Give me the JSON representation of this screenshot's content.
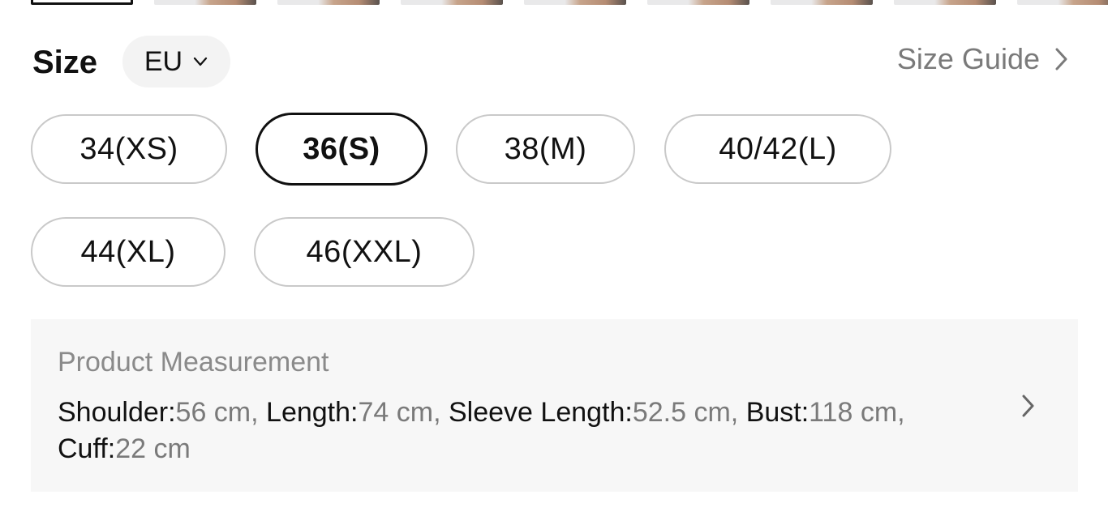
{
  "size_section": {
    "title": "Size",
    "unit": "EU",
    "size_guide_label": "Size Guide"
  },
  "sizes": [
    {
      "label": "34(XS)",
      "selected": false
    },
    {
      "label": "36(S)",
      "selected": true
    },
    {
      "label": "38(M)",
      "selected": false
    },
    {
      "label": "40/42(L)",
      "selected": false
    },
    {
      "label": "44(XL)",
      "selected": false
    },
    {
      "label": "46(XXL)",
      "selected": false
    }
  ],
  "measurement": {
    "title": "Product Measurement",
    "items": [
      {
        "name": "Shoulder:",
        "value": "56 cm,"
      },
      {
        "name": "Length:",
        "value": "74 cm,"
      },
      {
        "name": "Sleeve Length:",
        "value": "52.5 cm,"
      },
      {
        "name": "Bust:",
        "value": "118 cm,"
      },
      {
        "name": "Cuff:",
        "value": "22 cm"
      }
    ]
  },
  "icons": {
    "unit_dropdown": "chevron-down-icon",
    "size_guide": "chevron-right-icon",
    "measurement": "chevron-right-icon"
  },
  "colors": {
    "selected_border": "#111111",
    "chip_border": "#c9c9c9",
    "panel_bg": "#f7f7f7",
    "muted_text": "#7a7a7a"
  }
}
